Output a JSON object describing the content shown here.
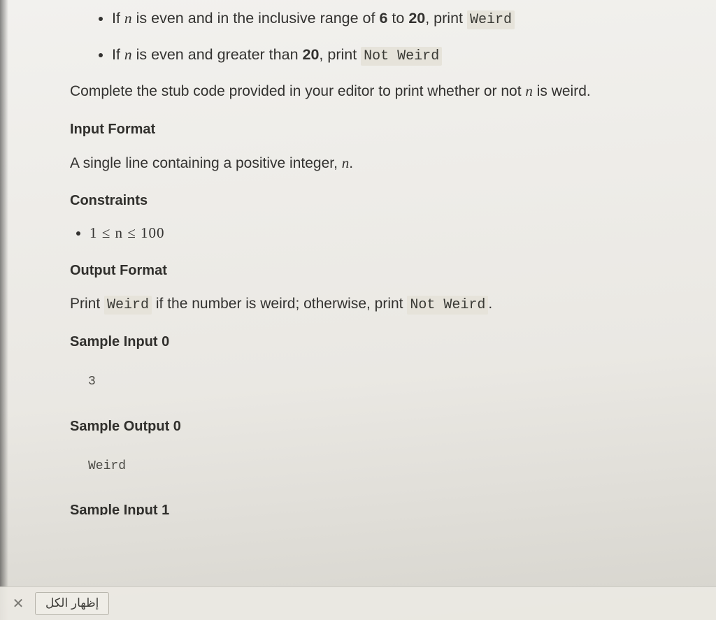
{
  "rules": [
    {
      "prefix": "If ",
      "var": "n",
      "mid": " is even and in the inclusive range of ",
      "a": "6",
      "to": " to ",
      "b": "20",
      "tail": ", print ",
      "code": "Weird"
    },
    {
      "prefix": "If ",
      "var": "n",
      "mid": " is even and greater than ",
      "a": "20",
      "to": "",
      "b": "",
      "tail": ", print ",
      "code": "Not Weird"
    }
  ],
  "instruction": {
    "pre": "Complete the stub code provided in your editor to print whether or not ",
    "var": "n",
    "post": " is weird."
  },
  "sections": {
    "input_format": "Input Format",
    "constraints": "Constraints",
    "output_format": "Output Format",
    "sample_input_0": "Sample Input 0",
    "sample_output_0": "Sample Output 0",
    "sample_input_1": "Sample Input 1"
  },
  "input_desc": {
    "pre": "A single line containing a positive integer, ",
    "var": "n",
    "post": "."
  },
  "constraint_line": "1 ≤ n ≤ 100",
  "output_desc": {
    "pre": "Print ",
    "code1": "Weird",
    "mid": " if the number is weird; otherwise, print ",
    "code2": "Not Weird",
    "post": "."
  },
  "samples": {
    "input0": "3",
    "output0": "Weird"
  },
  "bottombar": {
    "close": "✕",
    "button": "إظهار الكل"
  }
}
